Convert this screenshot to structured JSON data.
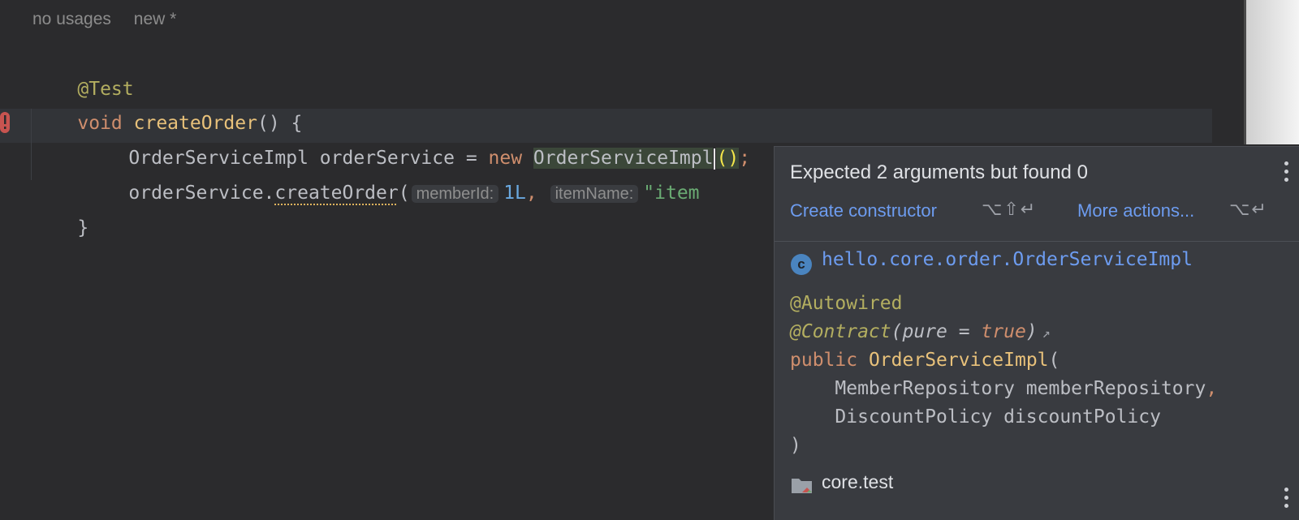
{
  "editor": {
    "meta_hints": {
      "usages": "no usages",
      "author": "new *"
    },
    "lines": {
      "annotation": "@Test",
      "method_kw": "void",
      "method_name": "createOrder",
      "method_rest": "() {",
      "l3_type": "OrderServiceImpl",
      "l3_var": " orderService = ",
      "l3_new": "new",
      "l3_class": "OrderServiceImpl",
      "l3_parens": "()",
      "l3_semi": ";",
      "l4_obj": "orderService.",
      "l4_call": "createOrder",
      "l4_open": "(",
      "l4_hint1": "memberId:",
      "l4_arg1": "1L",
      "l4_comma": ", ",
      "l4_hint2": "itemName:",
      "l4_arg2": "\"item",
      "closing": "}"
    }
  },
  "popup": {
    "title": "Expected 2 arguments but found 0",
    "action_primary": "Create constructor",
    "action_primary_shortcut": "⌥⇧↵",
    "action_more": "More actions...",
    "action_more_shortcut": "⌥↵",
    "class_icon_letter": "c",
    "fqcn": "hello.core.order.OrderServiceImpl",
    "doc": {
      "anno1": "@Autowired",
      "anno2": "@Contract",
      "anno2_args_open": "(pure = ",
      "anno2_true": "true",
      "anno2_close": ")",
      "public_kw": "public",
      "ctor_name": "OrderServiceImpl",
      "ctor_open": "(",
      "param1": "    MemberRepository memberRepository",
      "param1_comma": ",",
      "param2": "    DiscountPolicy discountPolicy",
      "ctor_close": ")"
    },
    "module": "core.test"
  },
  "colors": {
    "background": "#2b2b2d",
    "keyword": "#cf8e6d",
    "annotation": "#b3ae60",
    "function": "#e8c17a",
    "link": "#6d9cf0",
    "popup_bg": "#393b40"
  }
}
